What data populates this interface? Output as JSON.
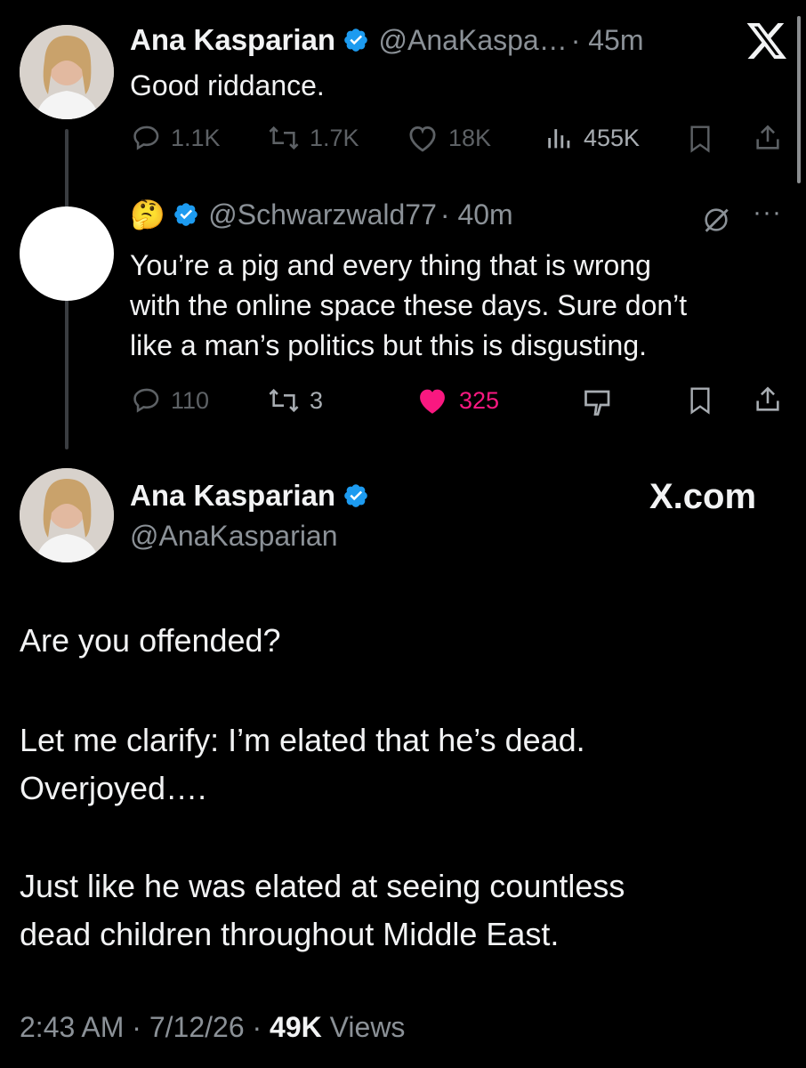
{
  "post1": {
    "name": "Ana Kasparian",
    "handle": "@AnaKaspa…",
    "time": "· 45m",
    "text": "Good riddance.",
    "stats": {
      "replies": "1.1K",
      "reposts": "1.7K",
      "likes": "18K",
      "views": "455K"
    }
  },
  "post2": {
    "emoji": "🤔",
    "handle": "@Schwarzwald77",
    "time": "· 40m",
    "more": "···",
    "text_lines": [
      "You’re a pig and every thing that is wrong",
      "with the online space these days.  Sure don’t",
      "like a man’s politics but this is disgusting."
    ],
    "stats": {
      "replies": "110",
      "reposts": "3",
      "likes": "325"
    }
  },
  "post3": {
    "name": "Ana Kasparian",
    "handle": "@AnaKasparian",
    "brand": "X.com",
    "text": {
      "p1": "Are you offended?",
      "p2_l1": "Let me clarify: I’m elated that he’s dead.",
      "p2_l2": "Overjoyed….",
      "p3_l1": "Just like he was elated at seeing countless",
      "p3_l2": "dead children throughout Middle East."
    },
    "meta": {
      "time": "2:43 AM",
      "date": "7/12/26",
      "views_count": "49K",
      "views_label": "Views"
    }
  },
  "colors": {
    "background": "#000000",
    "verified": "#1d9bf0",
    "like": "#f91880",
    "secondary": "#8b9197"
  },
  "icons": [
    "x-logo-icon",
    "verified-badge-icon",
    "reply-icon",
    "repost-icon",
    "heart-icon",
    "views-icon",
    "bookmark-icon",
    "share-icon",
    "grok-icon",
    "more-icon",
    "dislike-icon"
  ]
}
